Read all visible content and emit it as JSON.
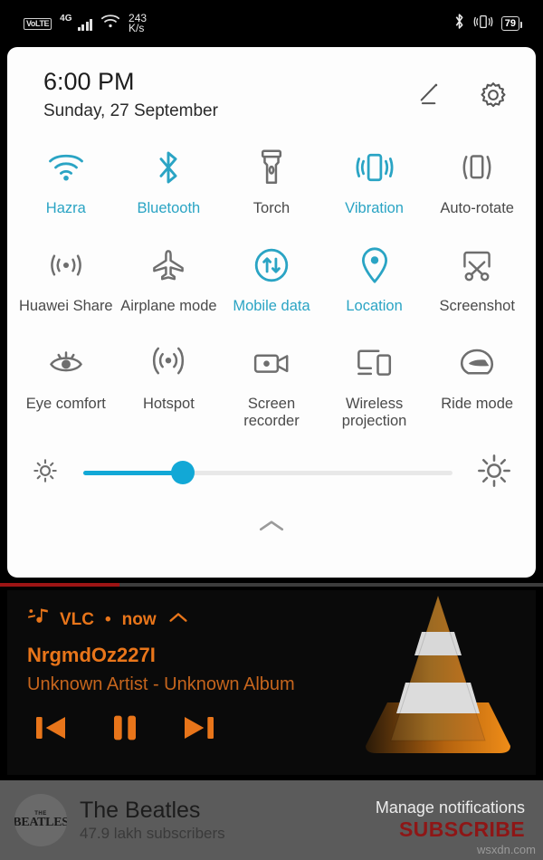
{
  "statusbar": {
    "volte_label": "VoLTE",
    "network_type": "4G",
    "data_rate_value": "243",
    "data_rate_unit": "K/s",
    "battery_percent": "79",
    "icons": [
      "signal-bars-icon",
      "wifi-icon",
      "bluetooth-icon",
      "vibrate-icon",
      "battery-icon"
    ]
  },
  "quick_settings": {
    "time": "6:00 PM",
    "date": "Sunday, 27 September",
    "edit_icon": "pencil-edit-icon",
    "settings_icon": "gear-icon",
    "accent_on_color": "#2aa4c4",
    "inactive_color": "#6e6e6e",
    "tiles": [
      {
        "label": "Hazra",
        "icon": "wifi-icon",
        "active": true
      },
      {
        "label": "Bluetooth",
        "icon": "bluetooth-icon",
        "active": true
      },
      {
        "label": "Torch",
        "icon": "flashlight-icon",
        "active": false
      },
      {
        "label": "Vibration",
        "icon": "vibrate-icon",
        "active": true
      },
      {
        "label": "Auto-rotate",
        "icon": "auto-rotate-icon",
        "active": false
      },
      {
        "label": "Huawei Share",
        "icon": "huawei-share-icon",
        "active": false
      },
      {
        "label": "Airplane mode",
        "icon": "airplane-icon",
        "active": false
      },
      {
        "label": "Mobile data",
        "icon": "mobile-data-icon",
        "active": true
      },
      {
        "label": "Location",
        "icon": "location-pin-icon",
        "active": true
      },
      {
        "label": "Screenshot",
        "icon": "screenshot-scissors-icon",
        "active": false
      },
      {
        "label": "Eye comfort",
        "icon": "eye-comfort-icon",
        "active": false
      },
      {
        "label": "Hotspot",
        "icon": "hotspot-icon",
        "active": false
      },
      {
        "label": "Screen recorder",
        "icon": "screen-recorder-icon",
        "active": false
      },
      {
        "label": "Wireless projection",
        "icon": "wireless-projection-icon",
        "active": false
      },
      {
        "label": "Ride mode",
        "icon": "helmet-icon",
        "active": false
      }
    ],
    "brightness": {
      "value_percent": 27,
      "low_icon": "brightness-low-icon",
      "high_icon": "brightness-high-icon",
      "fill_color": "#12a8d6"
    },
    "collapse_icon": "chevron-up-icon"
  },
  "media_notification": {
    "app_icon": "vlc-music-note-icon",
    "app_name": "VLC",
    "separator": "•",
    "time_label": "now",
    "expand_icon": "chevron-up-icon",
    "track_title": "NrgmdOz227I",
    "track_subtitle": "Unknown Artist - Unknown Album",
    "accent_color": "#e8751a",
    "controls": [
      {
        "name": "previous-button",
        "icon": "skip-previous-icon"
      },
      {
        "name": "pause-button",
        "icon": "pause-icon"
      },
      {
        "name": "next-button",
        "icon": "skip-next-icon"
      }
    ],
    "album_art": "vlc-traffic-cone-icon"
  },
  "video_progress": {
    "percent": 22,
    "fill_color": "#9c1414"
  },
  "youtube_channel": {
    "avatar_the": "THE",
    "avatar_name": "BEATLES",
    "channel_name": "The Beatles",
    "subscribers": "47.9 lakh subscribers",
    "manage_notifications": "Manage notifications",
    "subscribe_label": "SUBSCRIBE",
    "subscribe_color": "#8e1616"
  },
  "watermark": "wsxdn.com"
}
